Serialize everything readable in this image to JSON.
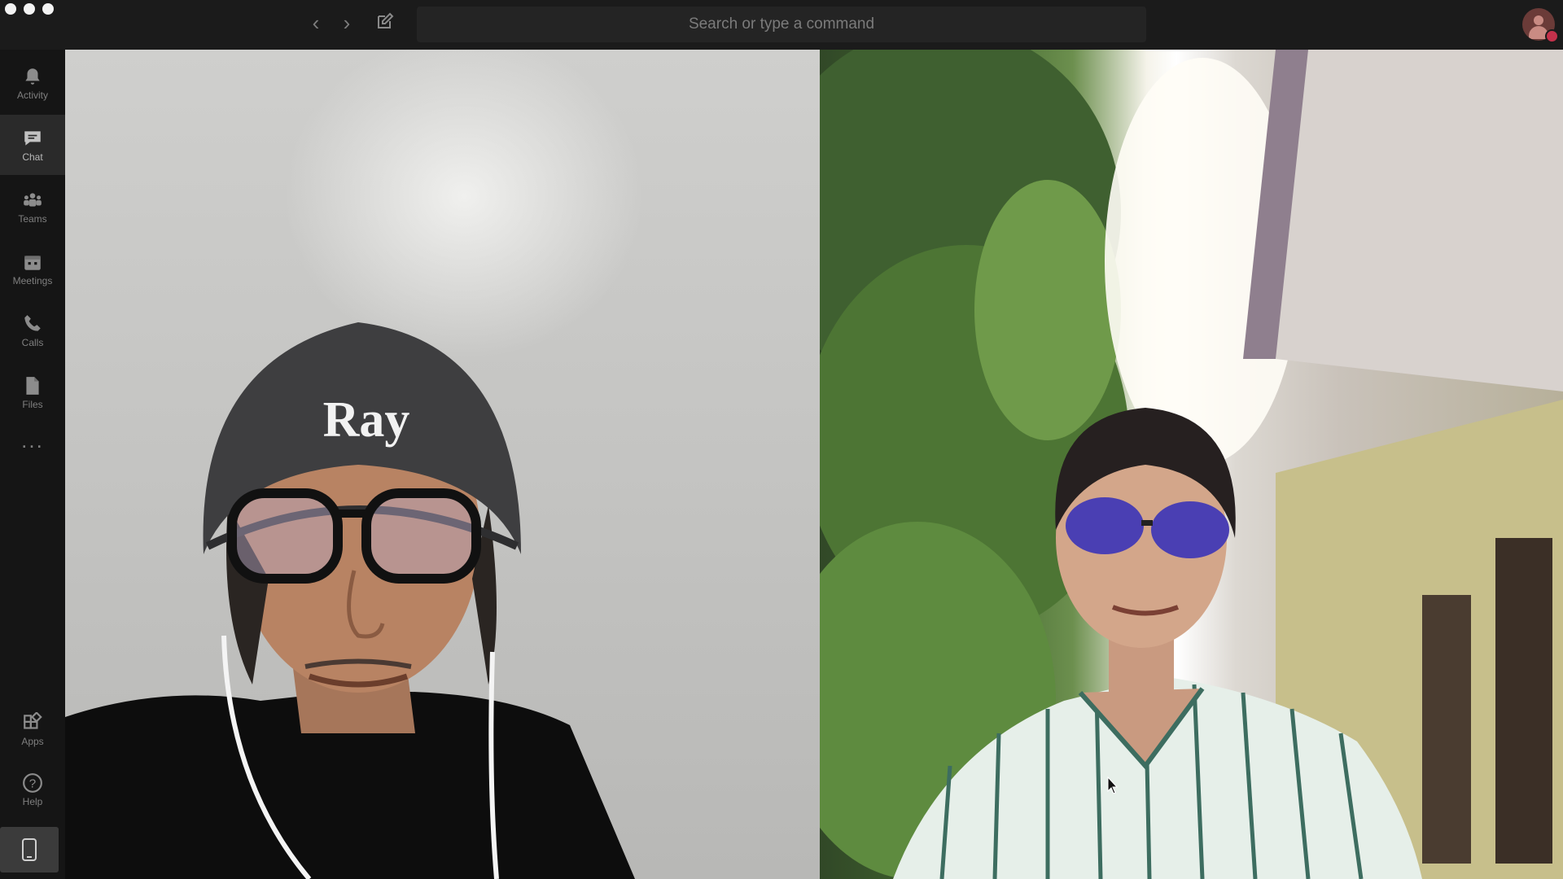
{
  "titlebar": {
    "search_placeholder": "Search or type a command"
  },
  "rail": {
    "items": [
      {
        "label": "Activity",
        "icon": "bell-icon",
        "active": false
      },
      {
        "label": "Chat",
        "icon": "chat-icon",
        "active": true
      },
      {
        "label": "Teams",
        "icon": "teams-icon",
        "active": false
      },
      {
        "label": "Meetings",
        "icon": "calendar-icon",
        "active": false
      },
      {
        "label": "Calls",
        "icon": "phone-icon",
        "active": false
      },
      {
        "label": "Files",
        "icon": "file-icon",
        "active": false
      }
    ],
    "more": "...",
    "bottom_items": [
      {
        "label": "Apps",
        "icon": "apps-icon"
      },
      {
        "label": "Help",
        "icon": "help-icon"
      }
    ]
  },
  "video": {
    "left_participant": {
      "hat_text": "Ray"
    }
  },
  "colors": {
    "titlebar": "#1b1b1b",
    "rail": "#151515",
    "presence_busy": "#c4314b"
  }
}
